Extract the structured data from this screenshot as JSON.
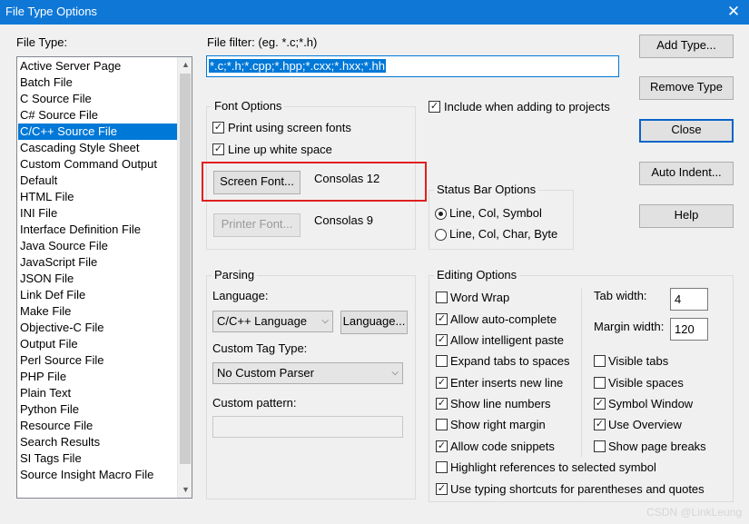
{
  "window": {
    "title": "File Type Options",
    "close_glyph": "✕"
  },
  "file_type": {
    "label": "File Type:",
    "items": [
      "Active Server Page",
      "Batch File",
      "C Source File",
      "C# Source File",
      "C/C++ Source File",
      "Cascading Style Sheet",
      "Custom Command Output",
      "Default",
      "HTML File",
      "INI File",
      "Interface Definition File",
      "Java Source File",
      "JavaScript File",
      "JSON File",
      "Link Def File",
      "Make File",
      "Objective-C File",
      "Output File",
      "Perl Source File",
      "PHP File",
      "Plain Text",
      "Python File",
      "Resource File",
      "Search Results",
      "SI Tags File",
      "Source Insight Macro File"
    ],
    "selected": "C/C++ Source File"
  },
  "file_filter": {
    "label": "File filter: (eg. *.c;*.h)",
    "value": "*.c;*.h;*.cpp;*.hpp;*.cxx;*.hxx;*.hh"
  },
  "font_options": {
    "title": "Font Options",
    "print_screen_fonts": {
      "label": "Print using screen fonts",
      "checked": true
    },
    "line_up_white_space": {
      "label": "Line up white space",
      "checked": true
    },
    "screen_font_button": "Screen Font...",
    "screen_font_value": "Consolas 12",
    "printer_font_button": "Printer Font...",
    "printer_font_value": "Consolas 9"
  },
  "include_projects": {
    "label": "Include when adding to projects",
    "checked": true
  },
  "status_bar": {
    "title": "Status Bar Options",
    "opt1": "Line, Col, Symbol",
    "opt2": "Line, Col, Char, Byte",
    "selected": "Line, Col, Symbol"
  },
  "buttons": {
    "add_type": "Add Type...",
    "remove_type": "Remove Type",
    "close": "Close",
    "auto_indent": "Auto Indent...",
    "help": "Help"
  },
  "parsing": {
    "title": "Parsing",
    "language_label": "Language:",
    "language_value": "C/C++ Language",
    "language_button": "Language...",
    "custom_tag_label": "Custom Tag Type:",
    "custom_tag_value": "No Custom Parser",
    "custom_pattern_label": "Custom pattern:",
    "custom_pattern_value": ""
  },
  "editing": {
    "title": "Editing Options",
    "word_wrap": {
      "label": "Word Wrap",
      "checked": false
    },
    "auto_complete": {
      "label": "Allow auto-complete",
      "checked": true
    },
    "intelligent_paste": {
      "label": "Allow intelligent paste",
      "checked": true
    },
    "expand_tabs": {
      "label": "Expand tabs to spaces",
      "checked": false
    },
    "enter_inserts": {
      "label": "Enter inserts new line",
      "checked": true
    },
    "show_line_numbers": {
      "label": "Show line numbers",
      "checked": true
    },
    "show_right_margin": {
      "label": "Show right margin",
      "checked": false
    },
    "code_snippets": {
      "label": "Allow code snippets",
      "checked": true
    },
    "highlight_refs": {
      "label": "Highlight references to selected symbol",
      "checked": false
    },
    "typing_shortcuts": {
      "label": "Use typing shortcuts for parentheses and quotes",
      "checked": true
    },
    "tab_width_label": "Tab width:",
    "tab_width_value": "4",
    "margin_width_label": "Margin width:",
    "margin_width_value": "120",
    "visible_tabs": {
      "label": "Visible tabs",
      "checked": false
    },
    "visible_spaces": {
      "label": "Visible spaces",
      "checked": false
    },
    "symbol_window": {
      "label": "Symbol Window",
      "checked": true
    },
    "use_overview": {
      "label": "Use Overview",
      "checked": true
    },
    "show_page_breaks": {
      "label": "Show page breaks",
      "checked": false
    }
  },
  "watermark": "CSDN @LinkLeung",
  "icons": {
    "check": "✓",
    "chevron_down": "⌵",
    "scroll_up": "▲",
    "scroll_down": "▼"
  }
}
